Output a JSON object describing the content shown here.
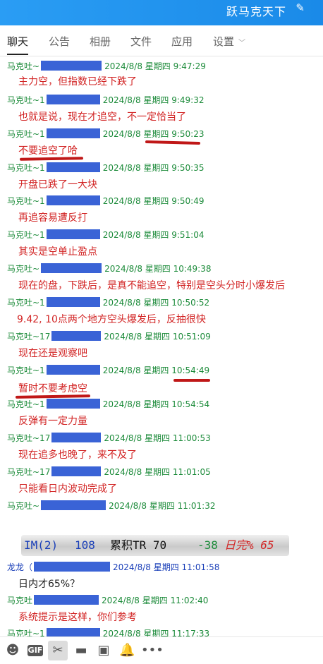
{
  "header": {
    "title": "跃马克天下"
  },
  "tabs": [
    {
      "label": "聊天"
    },
    {
      "label": "公告"
    },
    {
      "label": "相册"
    },
    {
      "label": "文件"
    },
    {
      "label": "应用"
    },
    {
      "label": "设置"
    }
  ],
  "messages": [
    {
      "sender": "马克吐~",
      "time": "2024/8/8 星期四 9:47:29",
      "text": "主力空，但指数已经下跌了"
    },
    {
      "sender": "马克吐~1",
      "time": "2024/8/8 星期四 9:49:32",
      "text": "也就是说，现在才追空，不一定恰当了"
    },
    {
      "sender": "马克吐~1",
      "time": "2024/8/8 星期四 9:50:23",
      "text": "不要追空了哈"
    },
    {
      "sender": "马克吐~1",
      "time": "2024/8/8 星期四 9:50:35",
      "text": "开盘已跌了一大块"
    },
    {
      "sender": "马克吐~1",
      "time": "2024/8/8 星期四 9:50:49",
      "text": "再追容易遭反打"
    },
    {
      "sender": "马克吐~1",
      "time": "2024/8/8 星期四 9:51:04",
      "text": "其实是空单止盈点"
    },
    {
      "sender": "马克吐~",
      "time": "2024/8/8 星期四 10:49:38",
      "text": "现在的盘，下跌后，是真不能追空，特别是空头分时小爆发后"
    },
    {
      "sender": "马克吐~1",
      "time": "2024/8/8 星期四 10:50:52",
      "text": "9.42, 10点两个地方空头爆发后，反抽很快"
    },
    {
      "sender": "马克吐~17",
      "time": "2024/8/8 星期四 10:51:09",
      "text": "现在还是观察吧"
    },
    {
      "sender": "马克吐~1",
      "time": "2024/8/8 星期四 10:54:49",
      "text": "暂时不要考虑空"
    },
    {
      "sender": "马克吐~1",
      "time": "2024/8/8 星期四 10:54:54",
      "text": "反弹有一定力量"
    },
    {
      "sender": "马克吐~17",
      "time": "2024/8/8 星期四 11:00:53",
      "text": "现在追多也晚了，来不及了"
    },
    {
      "sender": "马克吐~17",
      "time": "2024/8/8 星期四 11:01:05",
      "text": "只能看日内波动完成了"
    },
    {
      "sender": "马克吐~",
      "time": "2024/8/8 星期四 11:01:32",
      "text": ""
    },
    {
      "sender": "龙龙（",
      "time": "2024/8/8 星期四 11:01:58",
      "text": "日内才65%？"
    },
    {
      "sender": "马克吐",
      "time": "2024/8/8 星期四 11:02:40",
      "text": "系统提示是这样，你们参考"
    },
    {
      "sender": "马克吐~1",
      "time": "2024/8/8 星期四 11:17:33",
      "text": ""
    }
  ],
  "stock_bar": {
    "symbol": "IM(2)",
    "value": "108",
    "label": "累积TR 70",
    "change": "-38",
    "tail": "日完% 65"
  },
  "toolbar": {
    "icons": [
      "emoji-icon",
      "gif-icon",
      "scissors-icon",
      "folder-icon",
      "image-icon",
      "bell-icon",
      "more-icon"
    ],
    "gif_label": "GIF"
  },
  "colors": {
    "titlebar": "#1a8ae8",
    "sender": "#1c8b3a",
    "message": "#d22424",
    "redacted": "#3a63d6"
  }
}
